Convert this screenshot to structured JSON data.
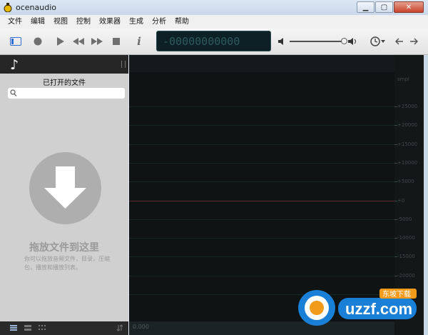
{
  "window": {
    "title": "ocenaudio"
  },
  "menu": [
    "文件",
    "编辑",
    "视图",
    "控制",
    "效果器",
    "生成",
    "分析",
    "帮助"
  ],
  "display": {
    "time": "-00000000000"
  },
  "volume": {
    "level": 0.96
  },
  "sidebar": {
    "title": "已打开的文件",
    "search_placeholder": "",
    "drop_title": "拖放文件到这里",
    "drop_desc": "你可以拖放音频文件，目录，压缩包，播放和播放列表。"
  },
  "waveform": {
    "time_label": "0.000",
    "amplitude_unit": "smpl",
    "amplitude_labels": [
      "+25000",
      "+20000",
      "+15000",
      "+10000",
      "+5000",
      "+0",
      "-5000",
      "-10000",
      "-15000",
      "-20000",
      "-25000"
    ]
  },
  "watermark": {
    "text": "uzzf.com",
    "tag": "东坡下载"
  },
  "colors": {
    "accent": "#2f6fd6",
    "zero_line": "#5b2a2f",
    "display_bg": "#0d2025"
  }
}
